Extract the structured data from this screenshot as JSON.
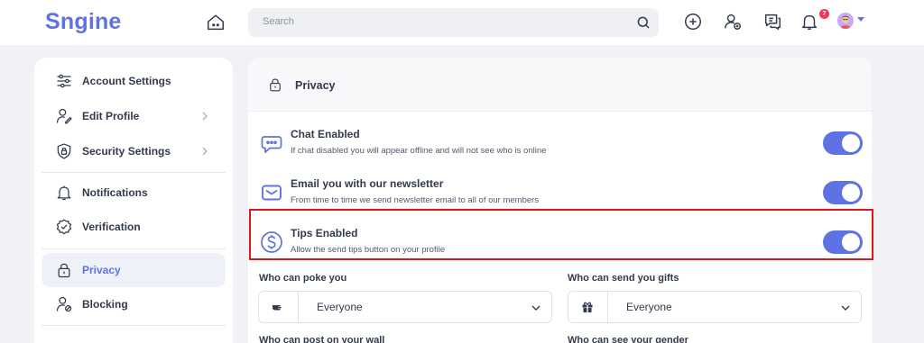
{
  "header": {
    "logo": "Sngine",
    "search_placeholder": "Search",
    "notifications_count": "7"
  },
  "sidebar": {
    "items": [
      {
        "label": "Account Settings",
        "icon": "sliders-icon"
      },
      {
        "label": "Edit Profile",
        "icon": "user-edit-icon"
      },
      {
        "label": "Security Settings",
        "icon": "shield-lock-icon"
      },
      {
        "label": "Notifications",
        "icon": "bell-icon"
      },
      {
        "label": "Verification",
        "icon": "verified-badge-icon"
      },
      {
        "label": "Privacy",
        "icon": "lock-icon"
      },
      {
        "label": "Blocking",
        "icon": "user-block-icon"
      }
    ]
  },
  "panel": {
    "title": "Privacy",
    "rows": [
      {
        "title": "Chat Enabled",
        "desc": "If chat disabled you will appear offline and will not see who is online",
        "enabled": true
      },
      {
        "title": "Email you with our newsletter",
        "desc": "From time to time we send newsletter email to all of our members",
        "enabled": true
      },
      {
        "title": "Tips Enabled",
        "desc": "Allow the send tips button on your profile",
        "enabled": true
      }
    ],
    "fields": [
      {
        "label": "Who can poke you",
        "value": "Everyone",
        "icon": "poke-hand-icon"
      },
      {
        "label": "Who can send you gifts",
        "value": "Everyone",
        "icon": "gift-icon"
      },
      {
        "label": "Who can post on your wall"
      },
      {
        "label": "Who can see your gender"
      }
    ]
  },
  "colors": {
    "accent": "#5e72e4",
    "highlight": "#e01515",
    "badge": "#f5365c"
  }
}
